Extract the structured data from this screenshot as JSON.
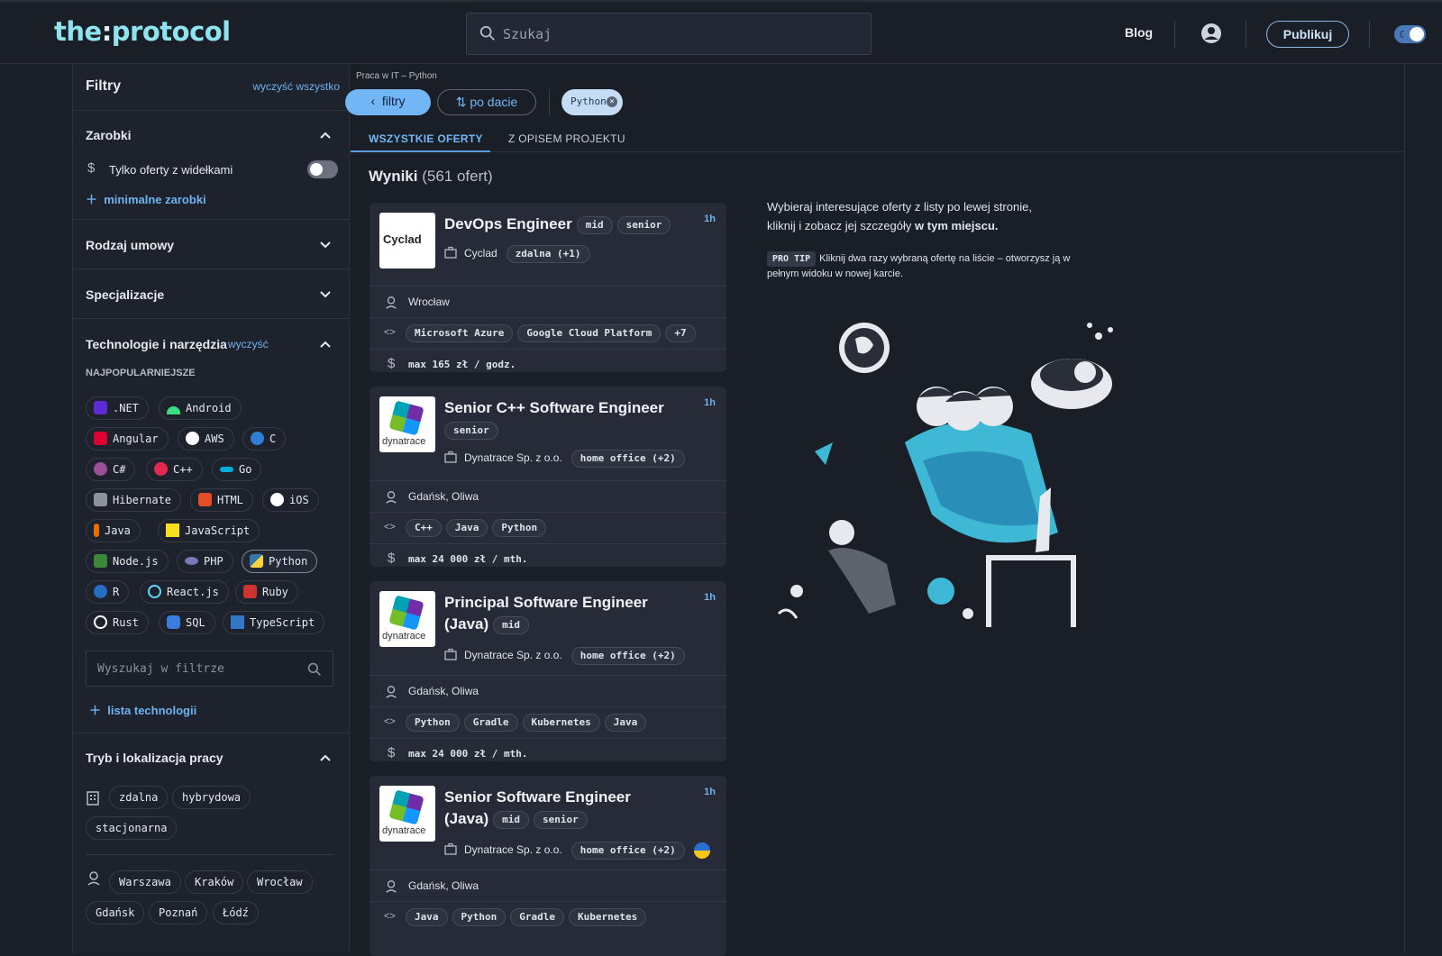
{
  "header": {
    "logo_a": "the",
    "logo_b": ":",
    "logo_c": "protocol",
    "search_placeholder": "Szukaj",
    "blog": "Blog",
    "publish": "Publikuj"
  },
  "sidebar": {
    "title": "Filtry",
    "clear_all": "wyczyść wszystko",
    "salary": {
      "title": "Zarobki",
      "toggle_label": "Tylko oferty z widełkami",
      "min_link": "minimalne zarobki"
    },
    "contract": {
      "title": "Rodzaj umowy"
    },
    "spec": {
      "title": "Specjalizacje"
    },
    "tech": {
      "title": "Technologie i narzędzia",
      "clear": "wyczyść",
      "popular": "NAJPOPULARNIEJSZE",
      "items": [
        ".NET",
        "Android",
        "Angular",
        "AWS",
        "C",
        "C#",
        "C++",
        "Go",
        "Hibernate",
        "HTML",
        "iOS",
        "Java",
        "JavaScript",
        "Node.js",
        "PHP",
        "Python",
        "R",
        "React.js",
        "Ruby",
        "Rust",
        "SQL",
        "TypeScript"
      ],
      "search_placeholder": "Wyszukaj w filtrze",
      "list_link": "lista technologii"
    },
    "mode": {
      "title": "Tryb i lokalizacja pracy",
      "modes": [
        "zdalna",
        "hybrydowa",
        "stacjonarna"
      ],
      "cities": [
        "Warszawa",
        "Kraków",
        "Wrocław",
        "Gdańsk",
        "Poznań",
        "Łódź"
      ]
    }
  },
  "main": {
    "breadcrumb": "Praca w IT – Python",
    "filters_btn": "filtry",
    "sort_btn": "po dacie",
    "active_filter": "Python",
    "tabs": [
      "WSZYSTKIE OFERTY",
      "Z OPISEM PROJEKTU"
    ],
    "results_label": "Wyniki",
    "results_count": "(561 ofert)",
    "info_line1": "Wybieraj interesujące oferty z listy po lewej stronie,",
    "info_line2": "kliknij i zobacz jej szczegóły",
    "info_bold": "w tym miejscu.",
    "tip_badge": "PRO TIP",
    "tip_text": "Kliknij dwa razy wybraną ofertę na liście – otworzysz ją w pełnym widoku w nowej karcie."
  },
  "offers": [
    {
      "title": "DevOps Engineer",
      "levels": [
        "mid",
        "senior"
      ],
      "time": "1h",
      "company": "Cyclad",
      "work": "zdalna (+1)",
      "location": "Wrocław",
      "tech": [
        "Microsoft Azure",
        "Google Cloud Platform",
        "+7"
      ],
      "salary": "max 165 zł / godz.",
      "logo": "Cyclad"
    },
    {
      "title": "Senior C++ Software Engineer",
      "levels": [
        "senior"
      ],
      "time": "1h",
      "company": "Dynatrace Sp. z o.o.",
      "work": "home office (+2)",
      "location": "Gdańsk, Oliwa",
      "tech": [
        "C++",
        "Java",
        "Python"
      ],
      "salary": "max 24 000 zł / mth.",
      "logo": "dynatrace"
    },
    {
      "title": "Principal Software Engineer",
      "title2": "(Java)",
      "levels": [
        "mid"
      ],
      "time": "1h",
      "company": "Dynatrace Sp. z o.o.",
      "work": "home office (+2)",
      "location": "Gdańsk, Oliwa",
      "tech": [
        "Python",
        "Gradle",
        "Kubernetes",
        "Java"
      ],
      "salary": "max 24 000 zł / mth.",
      "logo": "dynatrace"
    },
    {
      "title": "Senior Software Engineer",
      "title2": "(Java)",
      "levels": [
        "mid",
        "senior"
      ],
      "time": "1h",
      "company": "Dynatrace Sp. z o.o.",
      "work": "home office (+2)",
      "location": "Gdańsk, Oliwa",
      "tech": [
        "Java",
        "Python",
        "Gradle",
        "Kubernetes"
      ],
      "logo": "dynatrace"
    }
  ],
  "colors": {
    "bg": "#1a1e27",
    "accent": "#6fb2f0",
    "card": "#262b37"
  }
}
